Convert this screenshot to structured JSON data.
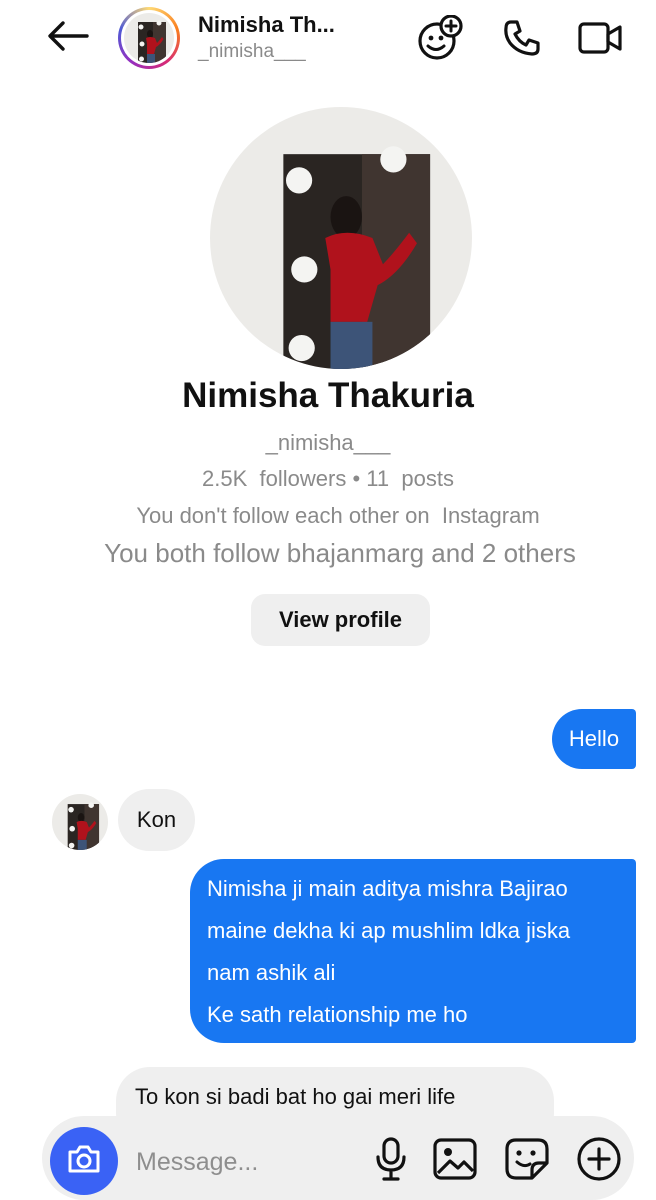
{
  "header": {
    "name": "Nimisha Th...",
    "username": "_nimisha___",
    "icons": [
      "back-arrow-icon",
      "add-people-icon",
      "phone-icon",
      "video-icon"
    ]
  },
  "profile": {
    "name": "Nimisha Thakuria",
    "username": "_nimisha___",
    "followers_count": "2.5K",
    "followers_label": "followers",
    "separator": "•",
    "posts_count": "11",
    "posts_label": "posts",
    "follow_status": "You don't follow each other on  Instagram",
    "mutual": "You both follow bhajanmarg and 2 others",
    "view_profile_label": "View profile"
  },
  "messages": [
    {
      "from": "me",
      "lines": [
        "Hello"
      ]
    },
    {
      "from": "them",
      "lines": [
        "Kon"
      ]
    },
    {
      "from": "me",
      "lines": [
        "Nimisha ji main aditya mishra Bajirao",
        "maine dekha ki ap mushlim ldka jiska",
        "nam ashik ali",
        "Ke sath relationship me ho"
      ]
    },
    {
      "from": "them",
      "lines": [
        "To kon si badi bat ho gai meri life"
      ]
    }
  ],
  "composer": {
    "placeholder": "Message...",
    "icons": [
      "camera-icon",
      "microphone-icon",
      "gallery-icon",
      "sticker-icon",
      "plus-icon"
    ]
  },
  "colors": {
    "sent_bubble": "#1877f2",
    "received_bubble": "#efefef",
    "camera_button": "#3a62f5",
    "muted_text": "#8a8a8a"
  }
}
